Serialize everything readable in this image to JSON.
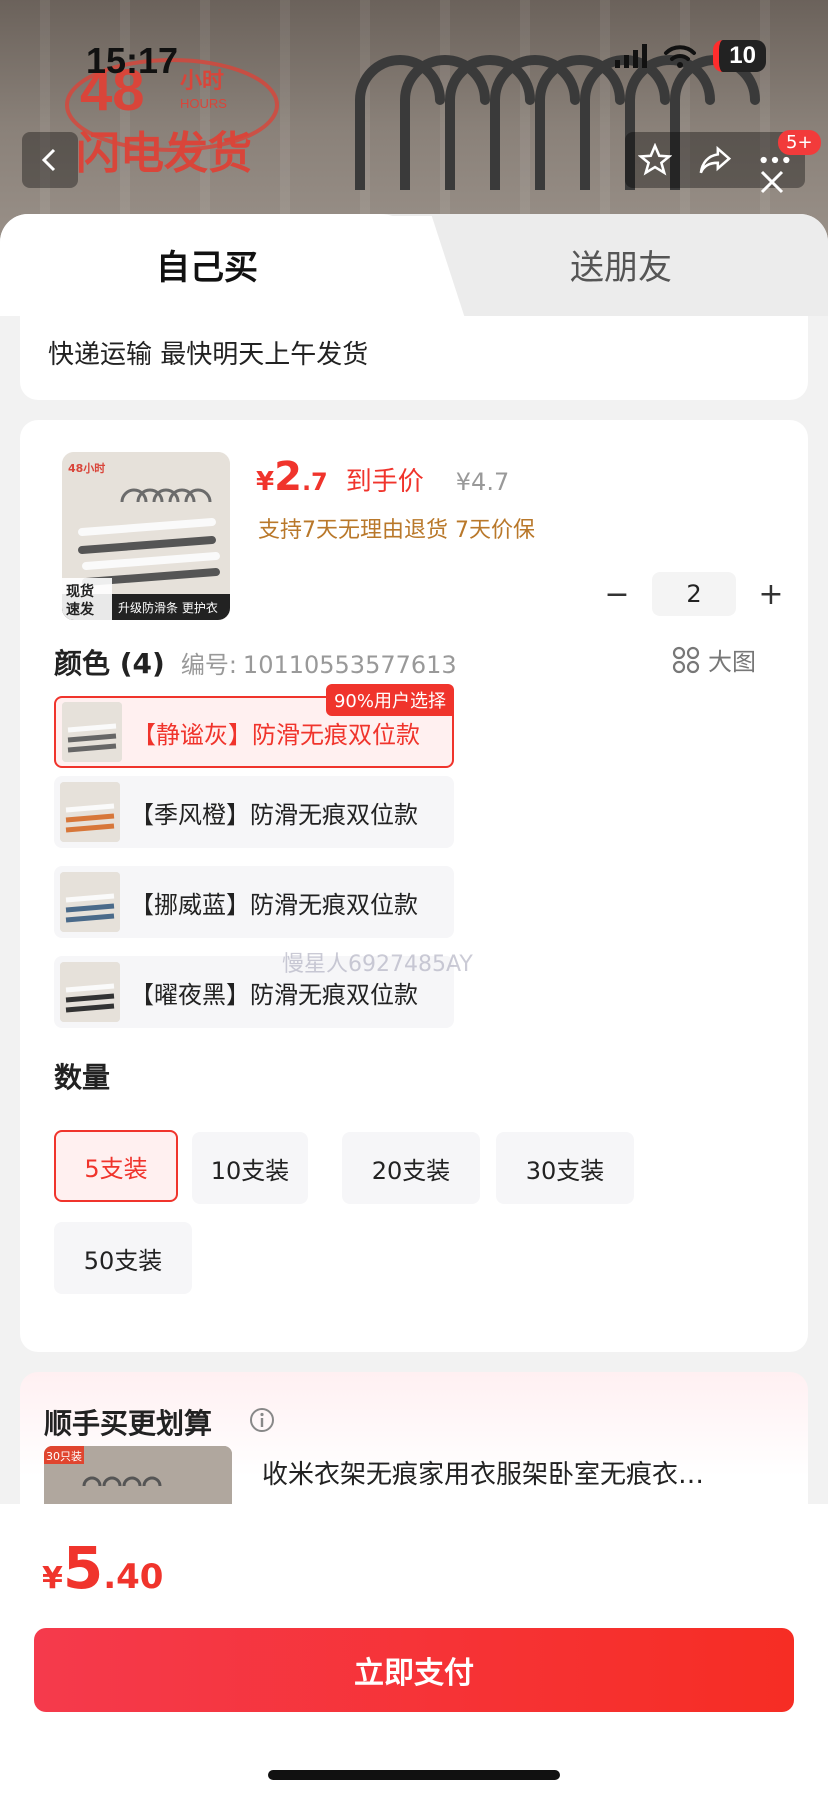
{
  "status_bar": {
    "time": "15:17",
    "battery": "10"
  },
  "header": {
    "logo_number": "48",
    "logo_unit": "小时",
    "logo_unit_en": "HOURS",
    "logo_text": "闪电发货",
    "notification_count": "5+"
  },
  "tabs": {
    "self": "自己买",
    "gift": "送朋友"
  },
  "shipping": {
    "text": "快递运输 最快明天上午发货"
  },
  "product": {
    "thumb_badge_top": "48小时",
    "thumb_badge_stock": "现货\n速发",
    "thumb_caption": "升级防滑条 更护衣",
    "price_yen": "¥",
    "price_int": "2",
    "price_dec": ".7",
    "price_tag": "到手价",
    "original_price": "¥4.7",
    "service": "支持7天无理由退货  7天价保",
    "quantity": "2",
    "minus": "−",
    "plus": "+"
  },
  "color": {
    "title": "颜色 (4)",
    "code_label": "编号:",
    "code_value": "10110553577613",
    "big_pic": "大图",
    "options": [
      {
        "label": "【静谧灰】防滑无痕双位款",
        "badge": "90%用户选择",
        "selected": true
      },
      {
        "label": "【季风橙】防滑无痕双位款",
        "selected": false
      },
      {
        "label": "【挪威蓝】防滑无痕双位款",
        "selected": false
      },
      {
        "label": "【曜夜黑】防滑无痕双位款",
        "selected": false
      }
    ]
  },
  "watermark": "慢星人6927485AY",
  "quantity_section": {
    "title": "数量",
    "options": [
      {
        "label": "5支装",
        "selected": true
      },
      {
        "label": "10支装",
        "selected": false
      },
      {
        "label": "20支装",
        "selected": false
      },
      {
        "label": "30支装",
        "selected": false
      },
      {
        "label": "50支装",
        "selected": false
      }
    ]
  },
  "more_deals": {
    "title": "顺手买更划算",
    "item_badge": "30只装",
    "item_name": "收米衣架无痕家用衣服架卧室无痕衣…"
  },
  "total": {
    "yen": "¥",
    "int": "5",
    "dec": ".40"
  },
  "pay_button": "立即支付",
  "colors": {
    "accent": "#f0342c",
    "service": "#b9782a",
    "pay_start": "#f53a4c",
    "pay_end": "#f62d24"
  }
}
